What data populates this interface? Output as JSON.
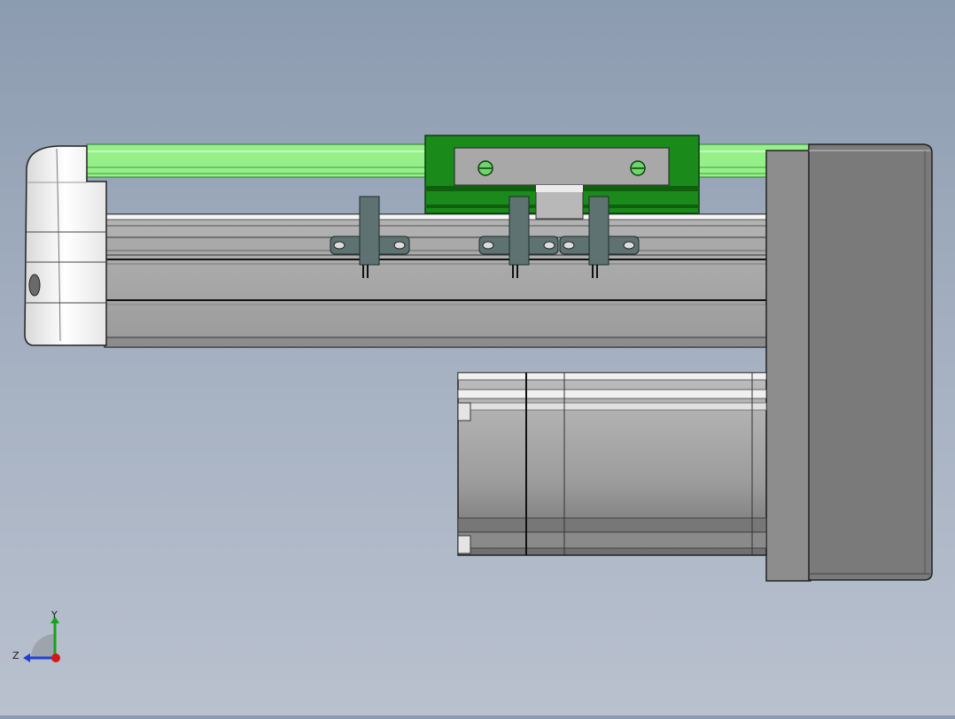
{
  "viewport": {
    "background_top": "#8c9bb0",
    "background_bottom": "#b9c1ce"
  },
  "model": {
    "rail_color": "#96f08a",
    "carriage_color": "#1a8a1a",
    "body_color": "#a8a8a8",
    "motor_color": "#9e9e9e",
    "flange_color": "#7a7a7a",
    "sensor_color": "#5e7272",
    "end_cap_color": "#f2f2f2"
  },
  "triad": {
    "y_label": "Y",
    "z_label": "Z",
    "y_axis_color": "#19a319",
    "z_axis_color": "#1f3fd8",
    "origin_color": "#d41818"
  }
}
